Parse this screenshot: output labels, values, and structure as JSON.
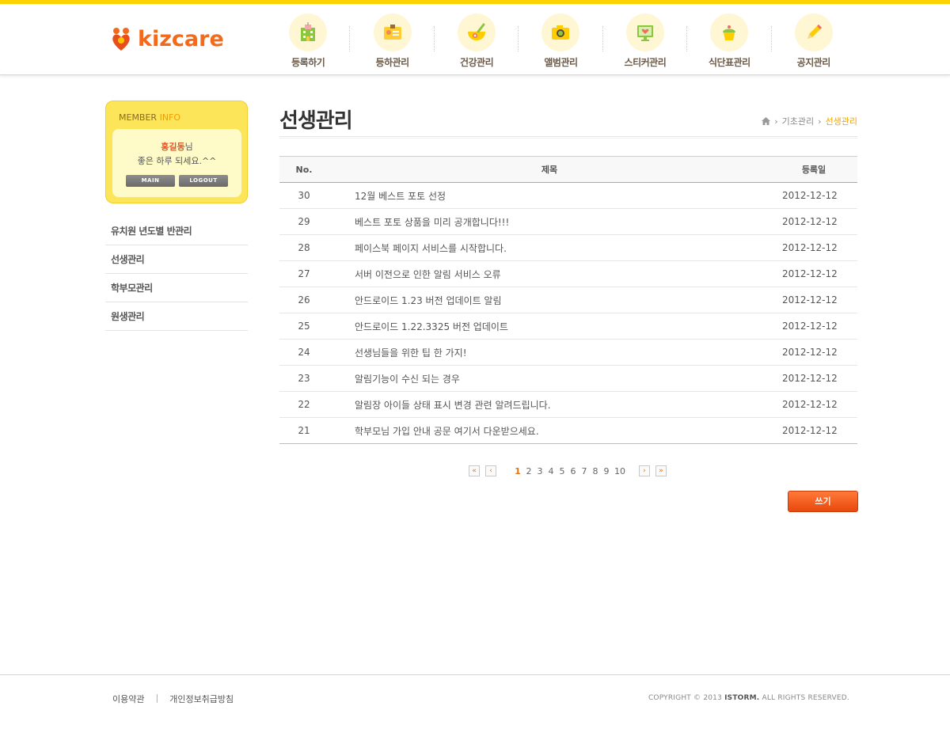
{
  "brand": {
    "logo_text": "kizcare",
    "accent": "#f26a1b",
    "topbar_color": "#ffd200"
  },
  "gnb": [
    {
      "label": "등록하기",
      "icon": "building-icon"
    },
    {
      "label": "등하관리",
      "icon": "id-card-icon"
    },
    {
      "label": "건강관리",
      "icon": "medicine-bowl-icon"
    },
    {
      "label": "앨범관리",
      "icon": "camera-icon"
    },
    {
      "label": "스티커관리",
      "icon": "heart-monitor-icon"
    },
    {
      "label": "식단표관리",
      "icon": "cupcake-icon"
    },
    {
      "label": "공지관리",
      "icon": "pencil-icon"
    }
  ],
  "member": {
    "title_a": "MEMBER",
    "title_b": "INFO",
    "name": "홍길동",
    "suffix": "님",
    "greeting": "좋은 하루 되세요.^^",
    "main_btn": "MAIN",
    "logout_btn": "LOGOUT"
  },
  "lnb": [
    "유치원 년도별 반관리",
    "선생관리",
    "학부모관리",
    "원생관리"
  ],
  "page": {
    "title": "선생관리",
    "breadcrumb": [
      "기초관리",
      "선생관리"
    ]
  },
  "board": {
    "headers": {
      "no": "No.",
      "subject": "제목",
      "date": "등록일"
    },
    "rows": [
      {
        "no": "30",
        "subject": "12월 베스트 포토 선정",
        "date": "2012-12-12"
      },
      {
        "no": "29",
        "subject": "베스트 포토 상품을 미리 공개합니다!!!",
        "date": "2012-12-12"
      },
      {
        "no": "28",
        "subject": "페이스북 페이지 서비스를 시작합니다.",
        "date": "2012-12-12"
      },
      {
        "no": "27",
        "subject": "서버 이전으로 인한 알림 서비스 오류",
        "date": "2012-12-12"
      },
      {
        "no": "26",
        "subject": "안드로이드 1.23 버전 업데이트 알림",
        "date": "2012-12-12"
      },
      {
        "no": "25",
        "subject": "안드로이드 1.22.3325 버전 업데이트",
        "date": "2012-12-12"
      },
      {
        "no": "24",
        "subject": "선생님들을 위한 팁 한 가지!",
        "date": "2012-12-12"
      },
      {
        "no": "23",
        "subject": "알림기능이 수신 되는 경우",
        "date": "2012-12-12"
      },
      {
        "no": "22",
        "subject": "알림장 아이들 상태 표시 변경 관련 알려드립니다.",
        "date": "2012-12-12"
      },
      {
        "no": "21",
        "subject": "학부모님 가입 안내 공문 여기서 다운받으세요.",
        "date": "2012-12-12"
      }
    ]
  },
  "paging": {
    "pages": [
      "1",
      "2",
      "3",
      "4",
      "5",
      "6",
      "7",
      "8",
      "9",
      "10"
    ],
    "current": "1"
  },
  "write_btn": "쓰기",
  "footer": {
    "terms": "이용약관",
    "divider": "|",
    "privacy": "개인정보취급방침",
    "copyright_a": "COPYRIGHT © 2013",
    "copyright_b": "ISTORM.",
    "copyright_c": "ALL RIGHTS RESERVED."
  }
}
